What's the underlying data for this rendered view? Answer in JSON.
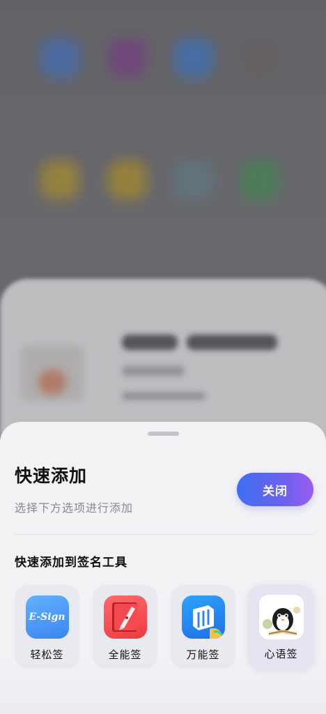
{
  "sheet": {
    "title": "快速添加",
    "subtitle": "选择下方选项进行添加",
    "close_label": "关闭",
    "section_title": "快速添加到签名工具",
    "tools": [
      {
        "label": "轻松签",
        "icon": "e-sign-icon",
        "icon_text": "E-Sign",
        "selected": false
      },
      {
        "label": "全能签",
        "icon": "pen-book-icon",
        "selected": false
      },
      {
        "label": "万能签",
        "icon": "layers-icon",
        "selected": false
      },
      {
        "label": "心语签",
        "icon": "penguin-icon",
        "selected": true
      }
    ]
  },
  "colors": {
    "accent_start": "#3d6ff2",
    "accent_end": "#9a5bef",
    "sheet_bg": "#f2f2f5"
  }
}
